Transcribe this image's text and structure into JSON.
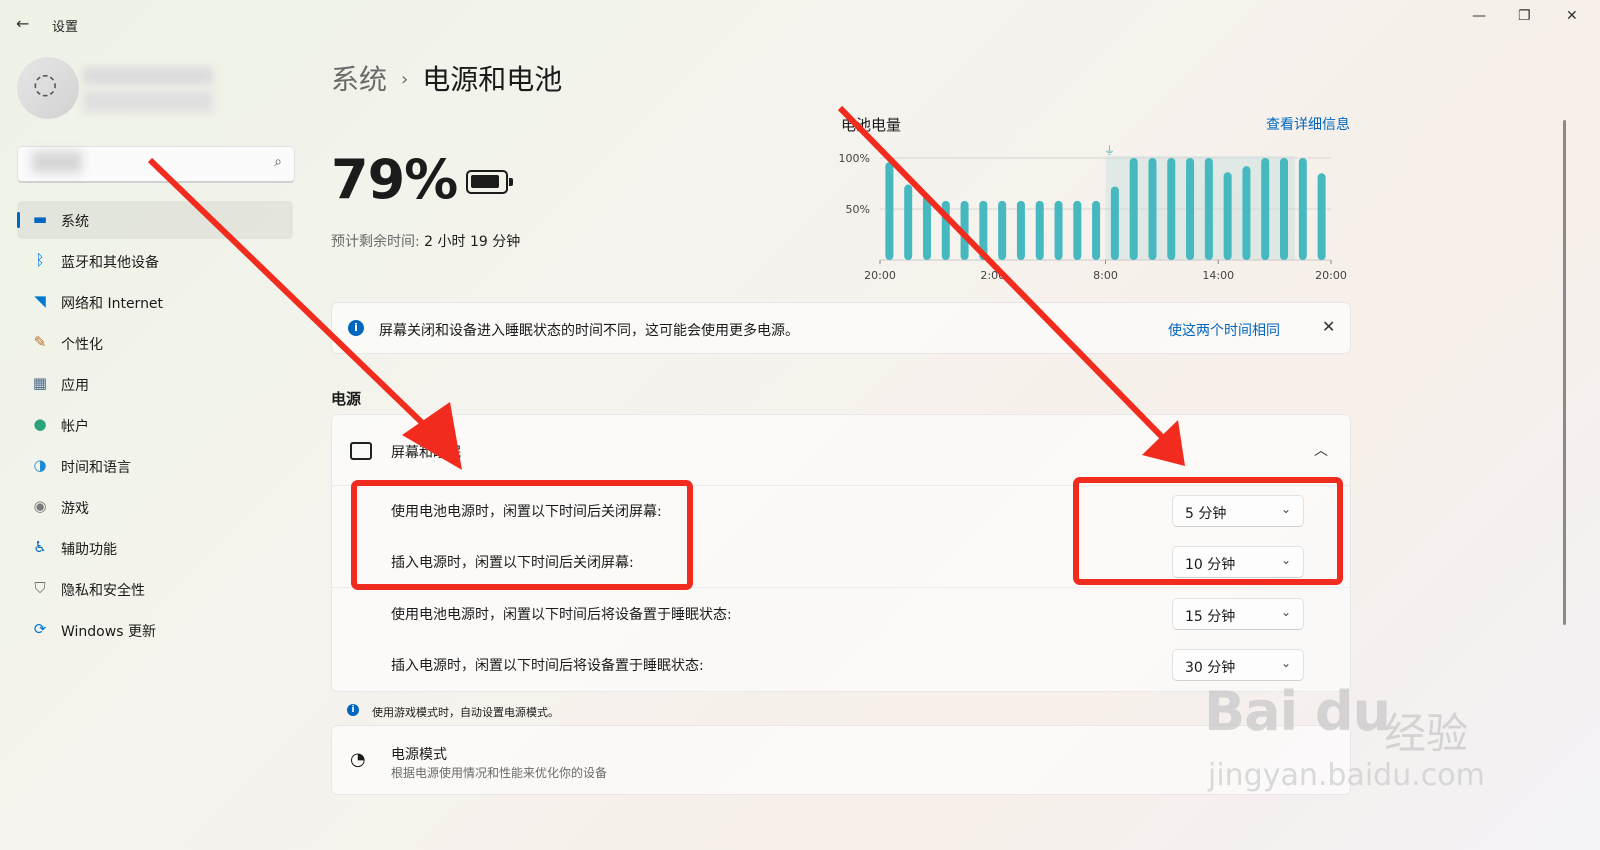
{
  "window": {
    "title": "设置",
    "back_icon": "arrow-left-icon"
  },
  "search": {
    "placeholder": ""
  },
  "nav": [
    {
      "label": "系统",
      "icon": "monitor-icon",
      "color": "#0067c0",
      "active": true
    },
    {
      "label": "蓝牙和其他设备",
      "icon": "bluetooth-icon",
      "color": "#0078d4"
    },
    {
      "label": "网络和 Internet",
      "icon": "wifi-icon",
      "color": "#0078d4"
    },
    {
      "label": "个性化",
      "icon": "brush-icon",
      "color": "#c46a2a"
    },
    {
      "label": "应用",
      "icon": "apps-icon",
      "color": "#4a6a8a"
    },
    {
      "label": "帐户",
      "icon": "person-icon",
      "color": "#2aa37a"
    },
    {
      "label": "时间和语言",
      "icon": "globe-clock-icon",
      "color": "#1a8ad4"
    },
    {
      "label": "游戏",
      "icon": "gamepad-icon",
      "color": "#7a7a7a"
    },
    {
      "label": "辅助功能",
      "icon": "accessibility-icon",
      "color": "#0067c0"
    },
    {
      "label": "隐私和安全性",
      "icon": "shield-icon",
      "color": "#707070"
    },
    {
      "label": "Windows 更新",
      "icon": "update-icon",
      "color": "#0078d4"
    }
  ],
  "breadcrumb": {
    "parent": "系统",
    "separator": "›",
    "current": "电源和电池"
  },
  "battery": {
    "percent": "79%",
    "level": 0.79,
    "remaining_label": "预计剩余时间:",
    "remaining_value": "2 小时 19 分钟"
  },
  "chart_data": {
    "type": "bar",
    "title": "电池电量",
    "link": "查看详细信息",
    "y_ticks": [
      "100%",
      "50%"
    ],
    "ylim": [
      0,
      100
    ],
    "x_ticks": [
      "20:00",
      "2:00",
      "8:00",
      "14:00",
      "20:00"
    ],
    "charging_marker": "plug-icon",
    "charging_from_bar": 12,
    "values": [
      96,
      74,
      64,
      58,
      58,
      58,
      58,
      58,
      58,
      58,
      58,
      58,
      72,
      100,
      100,
      100,
      100,
      100,
      86,
      92,
      100,
      100,
      100,
      85
    ],
    "color": "#45b8c0"
  },
  "info_bar": {
    "text": "屏幕关闭和设备进入睡眠状态的时间不同，这可能会使用更多电源。",
    "link": "使这两个时间相同"
  },
  "power_section": {
    "heading": "电源",
    "card_title": "屏幕和睡眠",
    "rows": [
      {
        "label": "使用电池电源时，闲置以下时间后关闭屏幕:",
        "value": "5 分钟"
      },
      {
        "label": "插入电源时，闲置以下时间后关闭屏幕:",
        "value": "10 分钟"
      },
      {
        "label": "使用电池电源时，闲置以下时间后将设备置于睡眠状态:",
        "value": "15 分钟"
      },
      {
        "label": "插入电源时，闲置以下时间后将设备置于睡眠状态:",
        "value": "30 分钟"
      }
    ]
  },
  "game_note": "使用游戏模式时，自动设置电源模式。",
  "power_mode": {
    "title": "电源模式",
    "subtitle": "根据电源使用情况和性能来优化你的设备"
  },
  "watermark": {
    "logo": "Bai du",
    "brand": "经验",
    "url": "jingyan.baidu.com"
  },
  "annotation_color": "#f22b1f"
}
